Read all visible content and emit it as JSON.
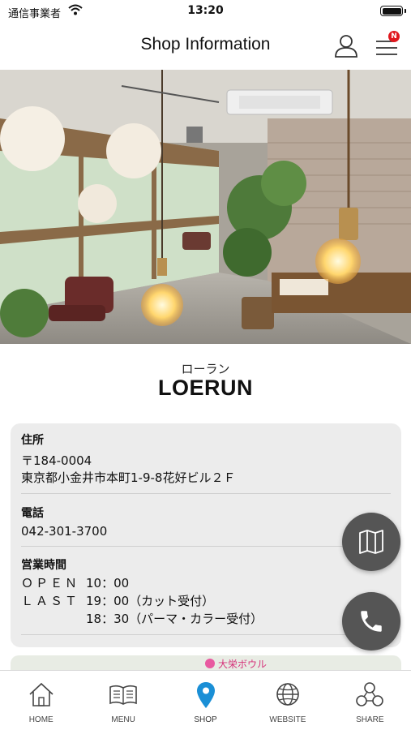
{
  "status_bar": {
    "carrier": "通信事業者",
    "time": "13:20"
  },
  "header": {
    "title": "Shop Information",
    "menu_badge": "N"
  },
  "shop": {
    "kana": "ローラン",
    "name": "LOERUN"
  },
  "info": {
    "address_label": "住所",
    "postal_code": "〒184-0004",
    "address": "東京都小金井市本町1-9-8花好ビル２Ｆ",
    "phone_label": "電話",
    "phone": "042-301-3700",
    "hours_label": "営業時間",
    "open_label": "ＯＰＥＮ",
    "open_time": "10：00",
    "last_label": "ＬＡＳＴ",
    "last_cut": "19：00（カット受付）",
    "last_perm": "18：30（パーマ・カラー受付）"
  },
  "map": {
    "landmark": "大栄ボウル"
  },
  "tabs": [
    {
      "label": "HOME",
      "icon": "home-icon"
    },
    {
      "label": "MENU",
      "icon": "book-icon"
    },
    {
      "label": "SHOP",
      "icon": "location-pin-icon",
      "active": true
    },
    {
      "label": "WEBSITE",
      "icon": "globe-icon"
    },
    {
      "label": "SHARE",
      "icon": "share-icon"
    }
  ],
  "colors": {
    "accent": "#1a8fd6",
    "badge": "#e0181e",
    "fab": "#555555",
    "card": "#ececec"
  }
}
